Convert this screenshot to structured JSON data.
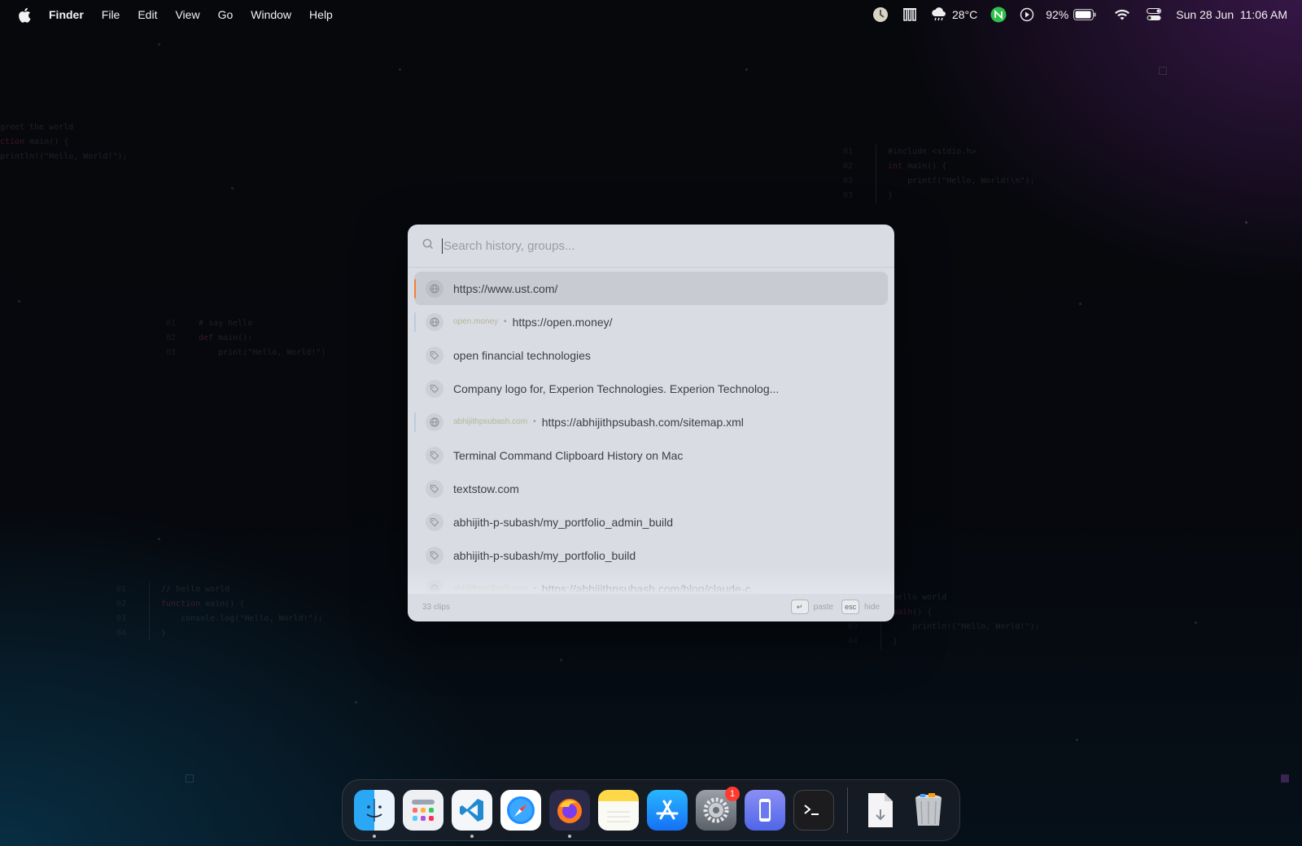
{
  "menubar": {
    "app_name": "Finder",
    "menus": [
      "File",
      "Edit",
      "View",
      "Go",
      "Window",
      "Help"
    ],
    "weather": "28°C",
    "battery": "92%",
    "datetime": "Sun 28 Jun  11:06 AM"
  },
  "panel": {
    "search_placeholder": "Search history, groups...",
    "items": [
      {
        "type": "url",
        "domain": "",
        "text": "https://www.ust.com/",
        "marker_color": "#f5813a",
        "selected": true
      },
      {
        "type": "url",
        "domain": "open.money",
        "text": "https://open.money/",
        "marker_color": "#b9cde0",
        "selected": false
      },
      {
        "type": "tag",
        "domain": "",
        "text": "open financial technologies",
        "marker_color": "",
        "selected": false
      },
      {
        "type": "tag",
        "domain": "",
        "text": "Company logo for, Experion Technologies. Experion Technolog...",
        "marker_color": "",
        "selected": false
      },
      {
        "type": "url",
        "domain": "abhijithpsubash.com",
        "text": "https://abhijithpsubash.com/sitemap.xml",
        "marker_color": "#b9cde0",
        "selected": false
      },
      {
        "type": "tag",
        "domain": "",
        "text": "Terminal Command Clipboard History on Mac",
        "marker_color": "",
        "selected": false
      },
      {
        "type": "tag",
        "domain": "",
        "text": "textstow.com",
        "marker_color": "",
        "selected": false
      },
      {
        "type": "tag",
        "domain": "",
        "text": "abhijith-p-subash/my_portfolio_admin_build",
        "marker_color": "",
        "selected": false
      },
      {
        "type": "tag",
        "domain": "",
        "text": "abhijith-p-subash/my_portfolio_build",
        "marker_color": "",
        "selected": false
      },
      {
        "type": "url",
        "domain": "abhijithpsubash.com",
        "text": "https://abhijithpsubash.com/blog/claude-c...",
        "marker_color": "",
        "selected": false
      }
    ],
    "footer": {
      "count": "33 clips",
      "enter_key": "↵",
      "enter_label": "paste",
      "esc_key": "esc",
      "esc_label": "hide"
    }
  },
  "dock": {
    "settings_badge": "1"
  },
  "colors": {
    "accent_marker": "#f5813a",
    "panel_bg": "#e2e5eb"
  }
}
